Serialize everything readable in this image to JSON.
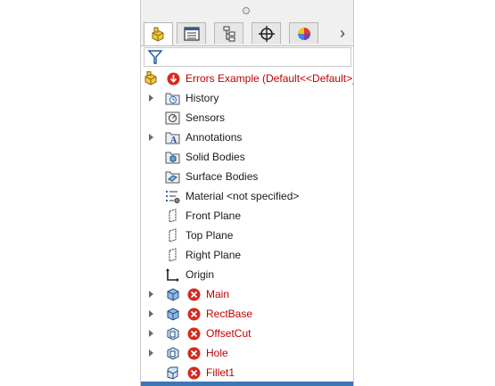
{
  "tabs": [
    {
      "name": "featuremanager",
      "icon": "part-icon"
    },
    {
      "name": "propertymanager",
      "icon": "property-list-icon"
    },
    {
      "name": "configurationmanager",
      "icon": "configuration-tree-icon"
    },
    {
      "name": "dimxpertmanager",
      "icon": "crosshair-icon"
    },
    {
      "name": "displaymanager",
      "icon": "color-wheel-icon"
    }
  ],
  "more_label": "›",
  "tree": {
    "root": "Errors Example  (Default<<Default>_",
    "items": [
      {
        "label": "History"
      },
      {
        "label": "Sensors"
      },
      {
        "label": "Annotations"
      },
      {
        "label": "Solid Bodies"
      },
      {
        "label": "Surface Bodies"
      },
      {
        "label": "Material <not specified>"
      },
      {
        "label": "Front Plane"
      },
      {
        "label": "Top Plane"
      },
      {
        "label": "Right Plane"
      },
      {
        "label": "Origin"
      },
      {
        "label": "Main"
      },
      {
        "label": "RectBase"
      },
      {
        "label": "OffsetCut"
      },
      {
        "label": "Hole"
      },
      {
        "label": "Fillet1"
      }
    ]
  },
  "colors": {
    "error": "#c00000",
    "accent": "#3c77b5"
  }
}
